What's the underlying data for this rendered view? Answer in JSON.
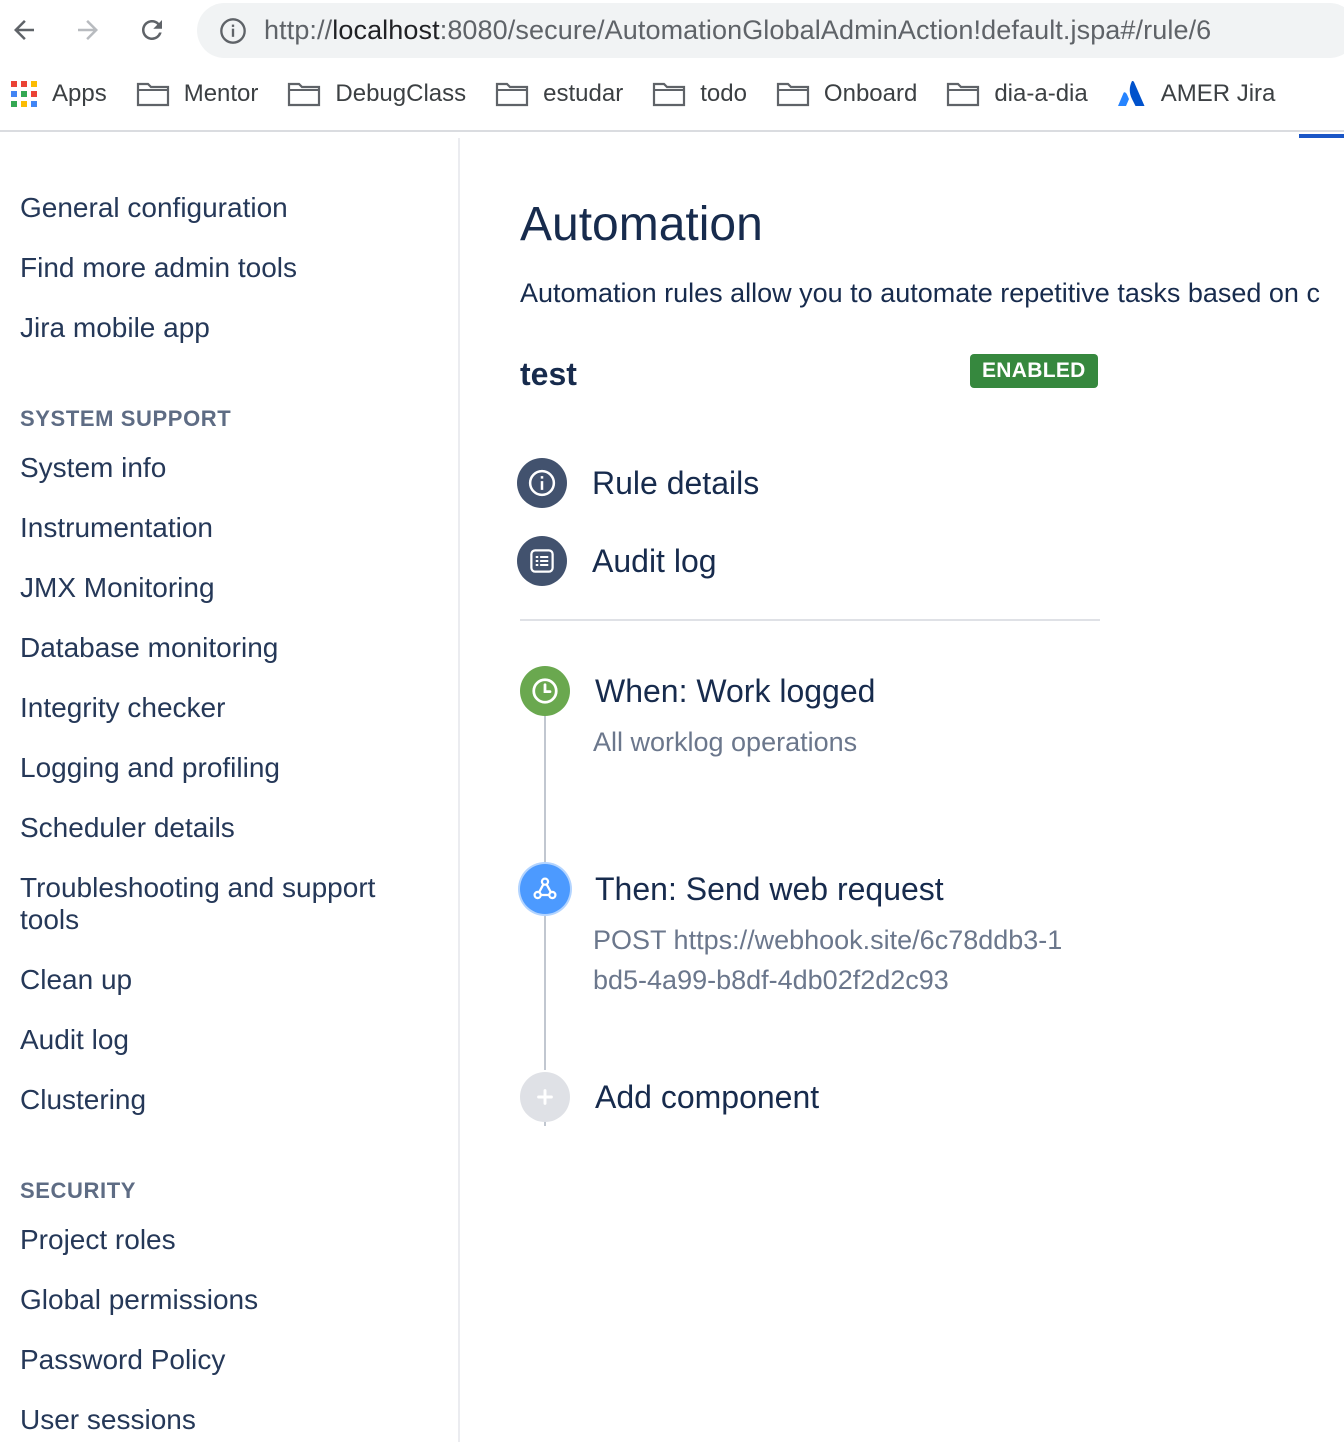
{
  "browser": {
    "url_scheme": "http://",
    "url_host": "localhost",
    "url_path": ":8080/secure/AutomationGlobalAdminAction!default.jspa#/rule/6",
    "bookmarks": [
      {
        "label": "Apps",
        "icon": "apps-grid-icon"
      },
      {
        "label": "Mentor",
        "icon": "folder-icon"
      },
      {
        "label": "DebugClass",
        "icon": "folder-icon"
      },
      {
        "label": "estudar",
        "icon": "folder-icon"
      },
      {
        "label": "todo",
        "icon": "folder-icon"
      },
      {
        "label": "Onboard",
        "icon": "folder-icon"
      },
      {
        "label": "dia-a-dia",
        "icon": "folder-icon"
      },
      {
        "label": "AMER Jira",
        "icon": "atlassian-logo-icon"
      }
    ]
  },
  "sidebar": {
    "top_links": [
      "General configuration",
      "Find more admin tools",
      "Jira mobile app"
    ],
    "system_support": {
      "heading": "SYSTEM SUPPORT",
      "items": [
        "System info",
        "Instrumentation",
        "JMX Monitoring",
        "Database monitoring",
        "Integrity checker",
        "Logging and profiling",
        "Scheduler details",
        "Troubleshooting and support tools",
        "Clean up",
        "Audit log",
        "Clustering"
      ]
    },
    "security": {
      "heading": "SECURITY",
      "items": [
        "Project roles",
        "Global permissions",
        "Password Policy",
        "User sessions"
      ]
    }
  },
  "main": {
    "title": "Automation",
    "description": "Automation rules allow you to automate repetitive tasks based on c",
    "rule": {
      "name": "test",
      "status": "ENABLED",
      "status_color": "#36883e"
    },
    "menu": [
      {
        "label": "Rule details",
        "icon": "info-icon"
      },
      {
        "label": "Audit log",
        "icon": "audit-log-icon"
      }
    ],
    "components": [
      {
        "title": "When: Work logged",
        "detail": "All worklog operations",
        "icon": "clock-icon",
        "color": "#6aa84f"
      },
      {
        "title": "Then: Send web request",
        "method": "POST",
        "detail": "https://webhook.site/6c78ddb3-1bd5-4a99-b8df-4db02f2d2c93",
        "icon": "webhook-icon",
        "color": "#4c9aff"
      },
      {
        "title": "Add component",
        "icon": "plus-icon",
        "color": "#c1c7d0"
      }
    ]
  }
}
